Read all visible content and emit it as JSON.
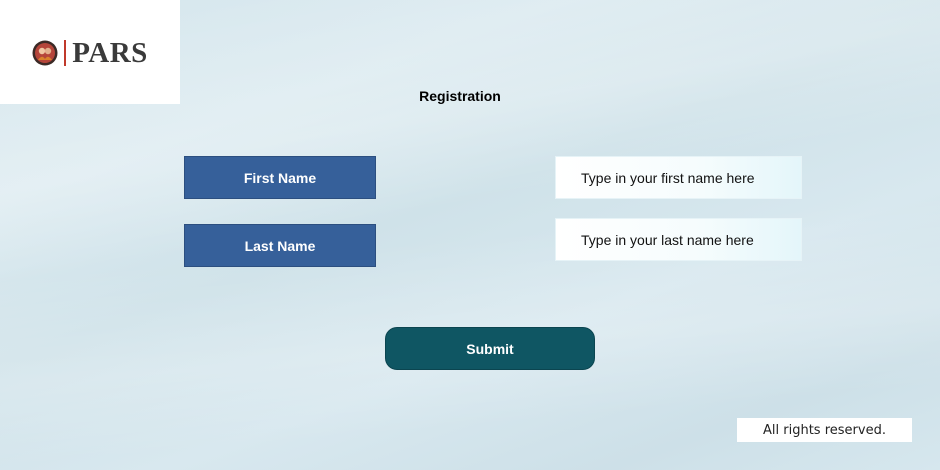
{
  "logo": {
    "text": "PARS",
    "icon": "seal-logo-icon"
  },
  "page": {
    "title": "Registration"
  },
  "form": {
    "first_name": {
      "label": "First Name",
      "placeholder": "Type in your first name here",
      "value": ""
    },
    "last_name": {
      "label": "Last Name",
      "placeholder": "Type in your last name here",
      "value": ""
    },
    "submit_label": "Submit"
  },
  "footer": {
    "text": "All rights reserved."
  },
  "colors": {
    "label_bg": "#36609a",
    "submit_bg": "#0f5663",
    "logo_accent": "#c0392b"
  }
}
